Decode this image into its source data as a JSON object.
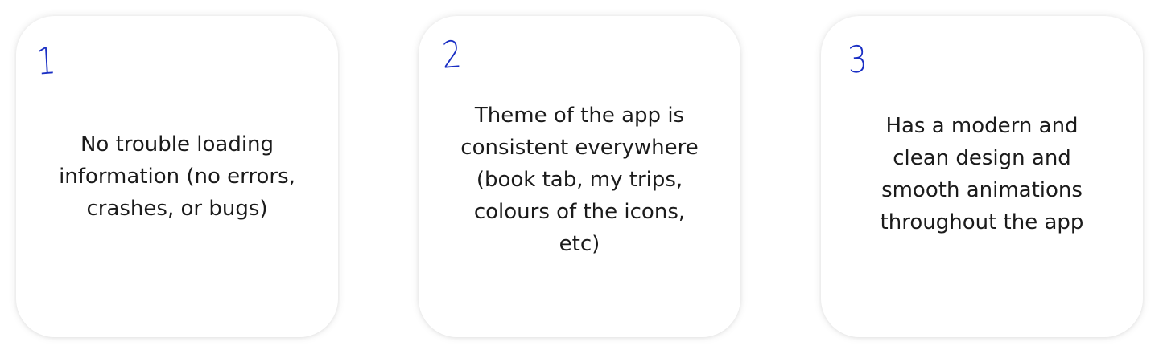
{
  "cards": [
    {
      "number": "1",
      "text": "No trouble loading information (no errors, crashes, or bugs)"
    },
    {
      "number": "2",
      "text": "Theme of the app is consistent everywhere (book tab, my trips, colours of the icons, etc)"
    },
    {
      "number": "3",
      "text": "Has a modern and clean design and smooth animations throughout the app"
    }
  ],
  "colors": {
    "number_ink": "#1a2fc4",
    "text": "#1b1b1b",
    "card_background": "#ffffff"
  }
}
